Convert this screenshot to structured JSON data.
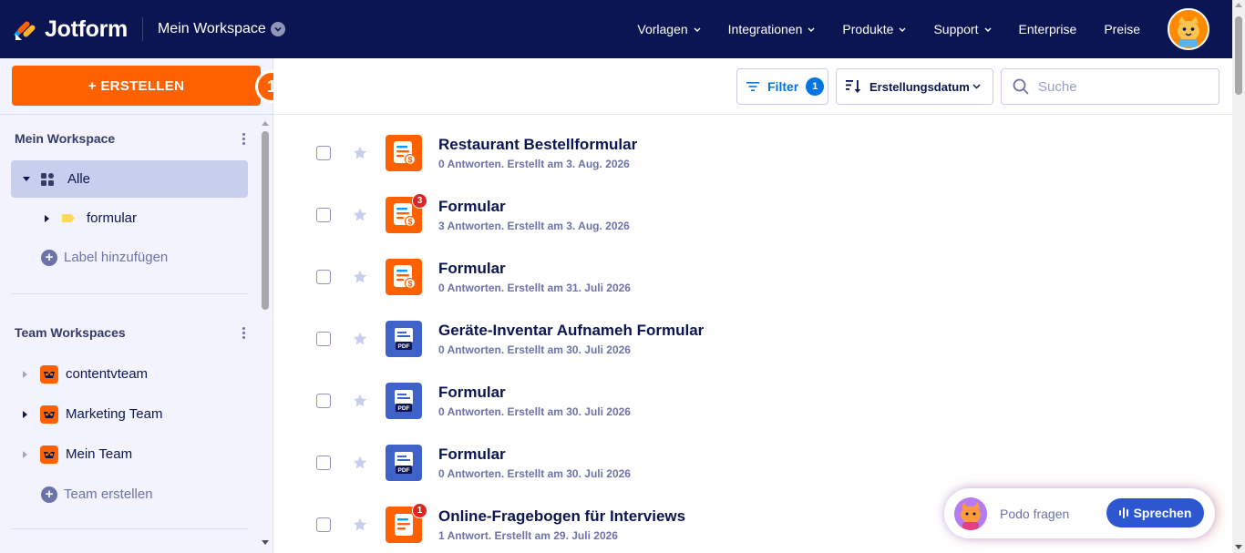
{
  "header": {
    "logo_text": "Jotform",
    "workspace": "Mein Workspace",
    "nav": [
      {
        "label": "Vorlagen",
        "dropdown": true
      },
      {
        "label": "Integrationen",
        "dropdown": true
      },
      {
        "label": "Produkte",
        "dropdown": true
      },
      {
        "label": "Support",
        "dropdown": true
      },
      {
        "label": "Enterprise",
        "dropdown": false
      },
      {
        "label": "Preise",
        "dropdown": false
      }
    ]
  },
  "sidebar": {
    "create_label": "+ ERSTELLEN",
    "step_badge": "1",
    "my_workspace": {
      "title": "Mein Workspace",
      "all_label": "Alle",
      "folder_label": "formular",
      "add_label": "Label hinzufügen"
    },
    "team_workspaces": {
      "title": "Team Workspaces",
      "teams": [
        "contentvteam",
        "Marketing Team",
        "Mein Team"
      ],
      "create_label": "Team erstellen"
    }
  },
  "toolbar": {
    "filter_label": "Filter",
    "filter_count": "1",
    "sort_label": "Erstellungsdatum",
    "search_placeholder": "Suche"
  },
  "forms": [
    {
      "title": "Restaurant Bestellformular",
      "meta": "0 Antworten. Erstellt am 3. Aug. 2026",
      "type": "payment-form",
      "badge": ""
    },
    {
      "title": "Formular",
      "meta": "3 Antworten. Erstellt am 3. Aug. 2026",
      "type": "payment-form",
      "badge": "3"
    },
    {
      "title": "Formular",
      "meta": "0 Antworten. Erstellt am 31. Juli 2026",
      "type": "payment-form",
      "badge": ""
    },
    {
      "title": "Geräte-Inventar Aufnameh Formular",
      "meta": "0 Antworten. Erstellt am 30. Juli 2026",
      "type": "pdf-form",
      "badge": ""
    },
    {
      "title": "Formular",
      "meta": "0 Antworten. Erstellt am 30. Juli 2026",
      "type": "pdf-form",
      "badge": ""
    },
    {
      "title": "Formular",
      "meta": "0 Antworten. Erstellt am 30. Juli 2026",
      "type": "pdf-form",
      "badge": ""
    },
    {
      "title": "Online-Fragebogen für Interviews",
      "meta": "1 Antwort. Erstellt am 29. Juli 2026",
      "type": "form",
      "badge": "1"
    }
  ],
  "pdf_tag": "PDF",
  "podo": {
    "label": "Podo fragen",
    "button_label": "Sprechen"
  },
  "colors": {
    "navy": "#0a1551",
    "orange": "#ff6100",
    "blue": "#0075e3",
    "pdf_blue": "#3e62c8"
  }
}
